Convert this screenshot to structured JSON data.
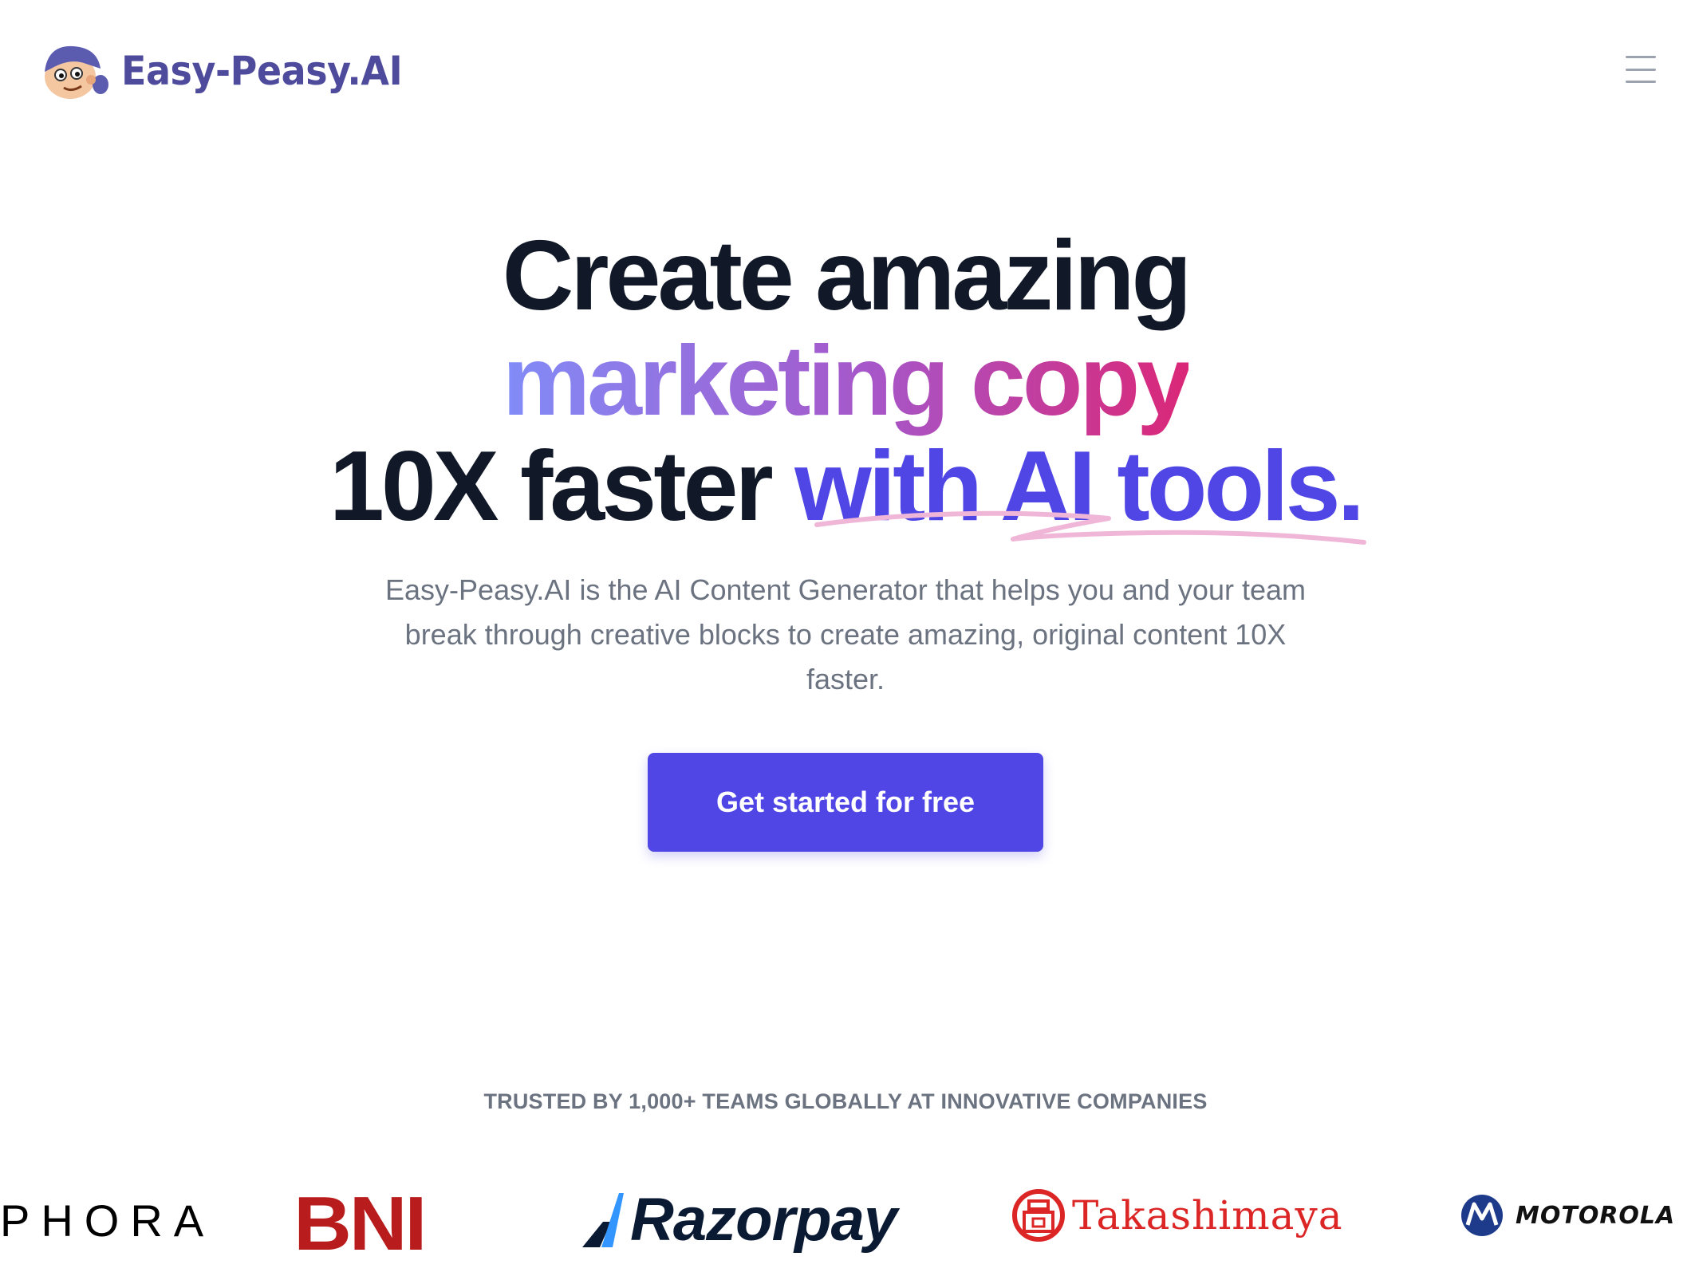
{
  "header": {
    "logo_text": "Easy-Peasy.AI",
    "logo_icon": "mascot-logo-icon",
    "menu_icon": "hamburger-menu-icon"
  },
  "hero": {
    "line1": "Create amazing",
    "line2": "marketing copy",
    "line3_plain": "10X faster ",
    "line3_accent": "with AI tools.",
    "subtitle": "Easy-Peasy.AI is the AI Content Generator that helps you and your team break through creative blocks to create amazing, original content 10X faster.",
    "cta_label": "Get started for free"
  },
  "trusted": {
    "heading": "TRUSTED BY 1,000+ TEAMS GLOBALLY AT INNOVATIVE COMPANIES",
    "logos": [
      {
        "name": "sephora",
        "text": "PHORA"
      },
      {
        "name": "bni",
        "text": "BNI"
      },
      {
        "name": "razorpay",
        "text": "Razorpay"
      },
      {
        "name": "takashimaya",
        "text": "Takashimaya"
      },
      {
        "name": "motorola",
        "text": "MOTOROLA"
      }
    ]
  },
  "colors": {
    "brand": "#4f46e5",
    "logo_text": "#4f4b9c",
    "heading": "#111827",
    "muted": "#6b7280",
    "gradient_start": "#818cf8",
    "gradient_end": "#db2777",
    "underline": "#f0b6d8"
  }
}
